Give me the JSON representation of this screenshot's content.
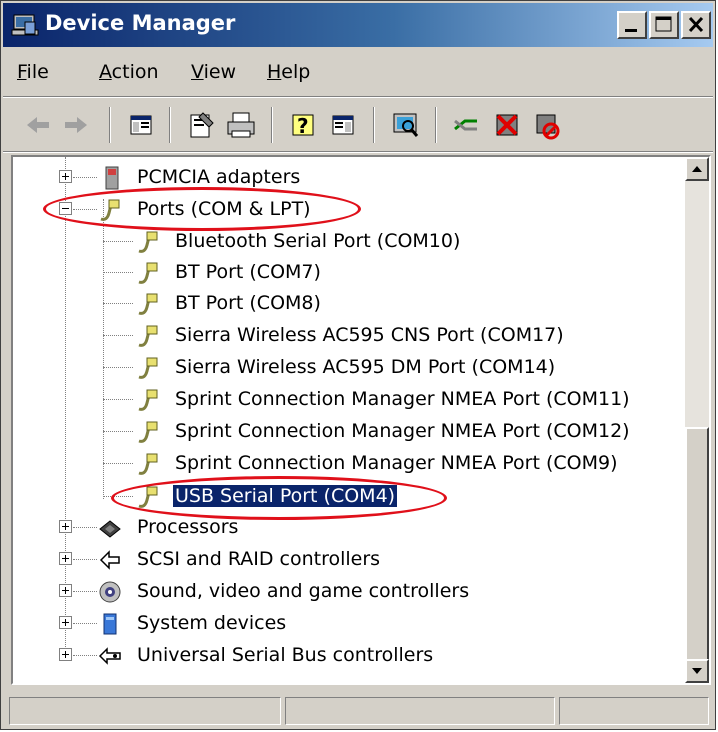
{
  "window": {
    "title": "Device Manager"
  },
  "menu": {
    "file": "File",
    "action": "Action",
    "view": "View",
    "help": "Help"
  },
  "toolbar": {
    "buttons": [
      "back-icon",
      "forward-icon",
      "console-tree-icon",
      "properties-icon",
      "print-icon",
      "help-icon",
      "action-pane-icon",
      "scan-hardware-icon",
      "update-driver-icon",
      "uninstall-icon",
      "disable-icon"
    ]
  },
  "tree": {
    "pcmcia": "PCMCIA adapters",
    "ports": "Ports (COM & LPT)",
    "port_items": [
      "Bluetooth Serial Port (COM10)",
      "BT Port (COM7)",
      "BT Port (COM8)",
      "Sierra Wireless AC595 CNS Port (COM17)",
      "Sierra Wireless AC595 DM Port (COM14)",
      "Sprint Connection Manager NMEA Port (COM11)",
      "Sprint Connection Manager NMEA Port (COM12)",
      "Sprint Connection Manager NMEA Port (COM9)",
      "USB Serial Port (COM4)"
    ],
    "processors": "Processors",
    "scsi": "SCSI and RAID controllers",
    "sound": "Sound, video and game controllers",
    "system": "System devices",
    "usb": "Universal Serial Bus controllers"
  },
  "colors": {
    "title_start": "#0a246a",
    "title_end": "#a6caf0",
    "selection": "#0a246a",
    "annotation": "#e0101a"
  }
}
